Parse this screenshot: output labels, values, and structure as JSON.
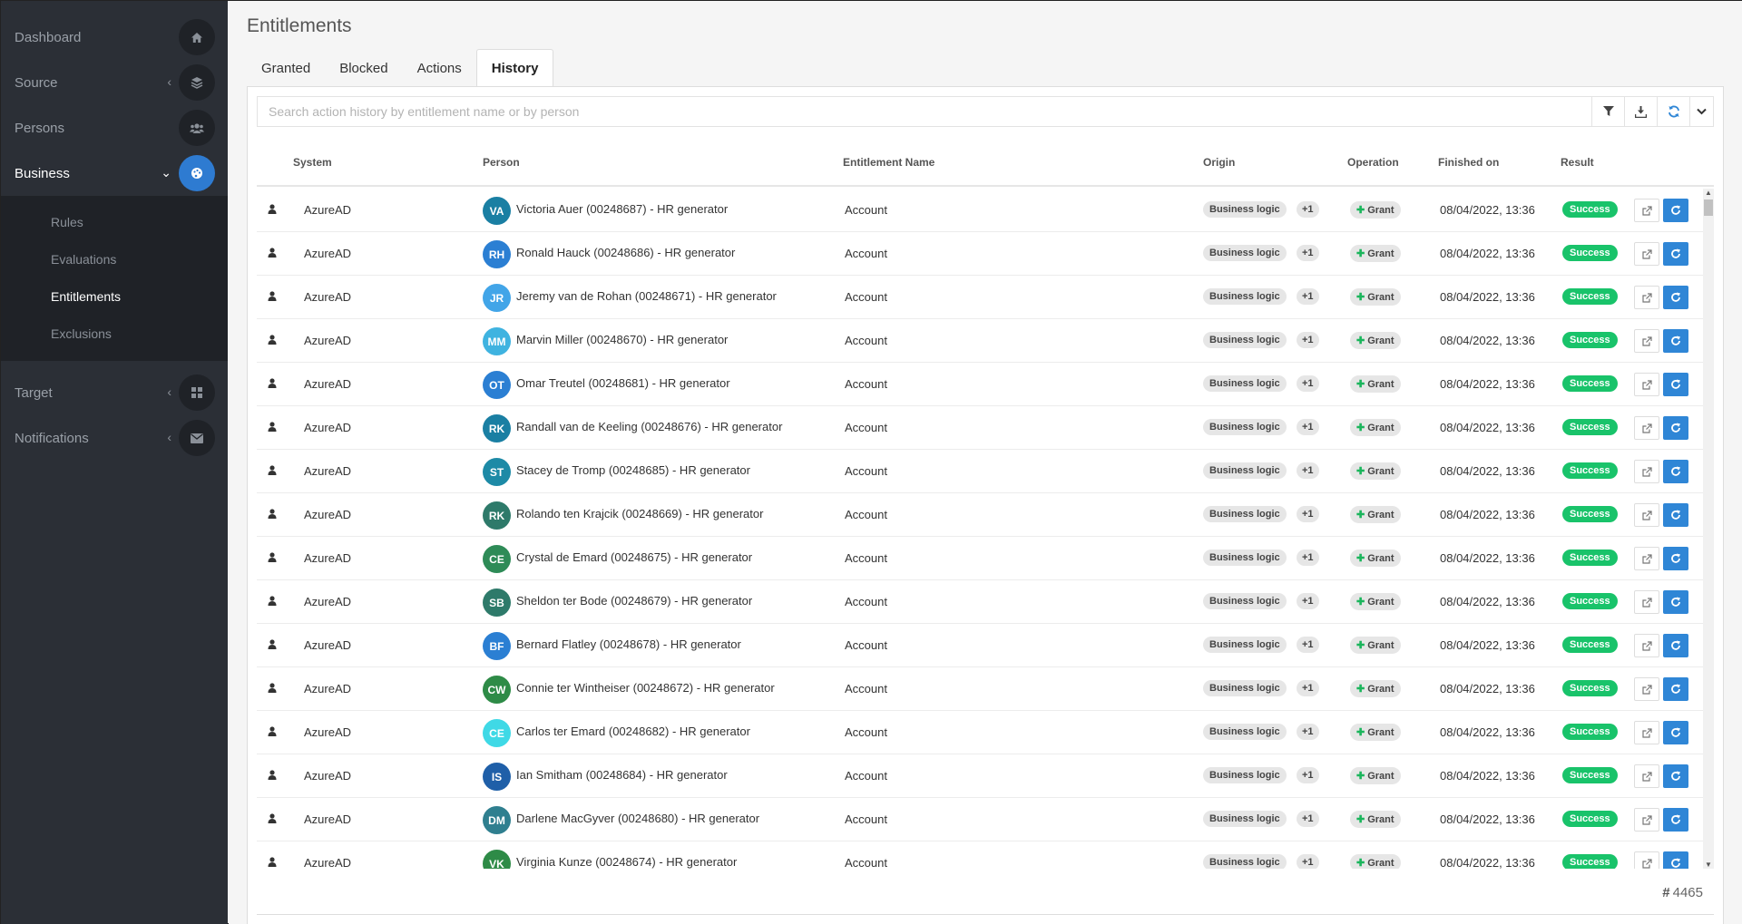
{
  "sidebar": {
    "items": [
      {
        "label": "Dashboard",
        "icon": "home-icon"
      },
      {
        "label": "Source",
        "icon": "layers-icon"
      },
      {
        "label": "Persons",
        "icon": "users-icon"
      },
      {
        "label": "Business",
        "icon": "palette-icon"
      },
      {
        "label": "Target",
        "icon": "grid-icon"
      },
      {
        "label": "Notifications",
        "icon": "envelope-icon"
      }
    ],
    "sub_items": [
      "Rules",
      "Evaluations",
      "Entitlements",
      "Exclusions"
    ]
  },
  "page": {
    "title": "Entitlements"
  },
  "tabs": [
    "Granted",
    "Blocked",
    "Actions",
    "History"
  ],
  "search": {
    "placeholder": "Search action history by entitlement name or by person"
  },
  "columns": {
    "system": "System",
    "person": "Person",
    "entitlement": "Entitlement Name",
    "origin": "Origin",
    "operation": "Operation",
    "finished": "Finished on",
    "result": "Result"
  },
  "rows": [
    {
      "system": "AzureAD",
      "initials": "VA",
      "color": "#1a7fa3",
      "person": "Victoria Auer (00248687) - HR generator",
      "entitlement": "Account",
      "origin": "Business logic",
      "extra": "+1",
      "operation": "Grant",
      "finished": "08/04/2022, 13:36",
      "result": "Success"
    },
    {
      "system": "AzureAD",
      "initials": "RH",
      "color": "#2b7fd3",
      "person": "Ronald Hauck (00248686) - HR generator",
      "entitlement": "Account",
      "origin": "Business logic",
      "extra": "+1",
      "operation": "Grant",
      "finished": "08/04/2022, 13:36",
      "result": "Success"
    },
    {
      "system": "AzureAD",
      "initials": "JR",
      "color": "#42a5e8",
      "person": "Jeremy van de Rohan (00248671) - HR generator",
      "entitlement": "Account",
      "origin": "Business logic",
      "extra": "+1",
      "operation": "Grant",
      "finished": "08/04/2022, 13:36",
      "result": "Success"
    },
    {
      "system": "AzureAD",
      "initials": "MM",
      "color": "#3fb3e0",
      "person": "Marvin Miller (00248670) - HR generator",
      "entitlement": "Account",
      "origin": "Business logic",
      "extra": "+1",
      "operation": "Grant",
      "finished": "08/04/2022, 13:36",
      "result": "Success"
    },
    {
      "system": "AzureAD",
      "initials": "OT",
      "color": "#2b7fd3",
      "person": "Omar Treutel (00248681) - HR generator",
      "entitlement": "Account",
      "origin": "Business logic",
      "extra": "+1",
      "operation": "Grant",
      "finished": "08/04/2022, 13:36",
      "result": "Success"
    },
    {
      "system": "AzureAD",
      "initials": "RK",
      "color": "#1a7fa3",
      "person": "Randall van de Keeling (00248676) - HR generator",
      "entitlement": "Account",
      "origin": "Business logic",
      "extra": "+1",
      "operation": "Grant",
      "finished": "08/04/2022, 13:36",
      "result": "Success"
    },
    {
      "system": "AzureAD",
      "initials": "ST",
      "color": "#1d8aa6",
      "person": "Stacey de Tromp (00248685) - HR generator",
      "entitlement": "Account",
      "origin": "Business logic",
      "extra": "+1",
      "operation": "Grant",
      "finished": "08/04/2022, 13:36",
      "result": "Success"
    },
    {
      "system": "AzureAD",
      "initials": "RK",
      "color": "#2e7a6a",
      "person": "Rolando ten Krajcik (00248669) - HR generator",
      "entitlement": "Account",
      "origin": "Business logic",
      "extra": "+1",
      "operation": "Grant",
      "finished": "08/04/2022, 13:36",
      "result": "Success"
    },
    {
      "system": "AzureAD",
      "initials": "CE",
      "color": "#2e8b57",
      "person": "Crystal de Emard (00248675) - HR generator",
      "entitlement": "Account",
      "origin": "Business logic",
      "extra": "+1",
      "operation": "Grant",
      "finished": "08/04/2022, 13:36",
      "result": "Success"
    },
    {
      "system": "AzureAD",
      "initials": "SB",
      "color": "#2e7a6a",
      "person": "Sheldon ter Bode (00248679) - HR generator",
      "entitlement": "Account",
      "origin": "Business logic",
      "extra": "+1",
      "operation": "Grant",
      "finished": "08/04/2022, 13:36",
      "result": "Success"
    },
    {
      "system": "AzureAD",
      "initials": "BF",
      "color": "#2b7fd3",
      "person": "Bernard Flatley (00248678) - HR generator",
      "entitlement": "Account",
      "origin": "Business logic",
      "extra": "+1",
      "operation": "Grant",
      "finished": "08/04/2022, 13:36",
      "result": "Success"
    },
    {
      "system": "AzureAD",
      "initials": "CW",
      "color": "#2e8b47",
      "person": "Connie ter Wintheiser (00248672) - HR generator",
      "entitlement": "Account",
      "origin": "Business logic",
      "extra": "+1",
      "operation": "Grant",
      "finished": "08/04/2022, 13:36",
      "result": "Success"
    },
    {
      "system": "AzureAD",
      "initials": "CE",
      "color": "#3fd9e6",
      "person": "Carlos ter Emard (00248682) - HR generator",
      "entitlement": "Account",
      "origin": "Business logic",
      "extra": "+1",
      "operation": "Grant",
      "finished": "08/04/2022, 13:36",
      "result": "Success"
    },
    {
      "system": "AzureAD",
      "initials": "IS",
      "color": "#1f5fa8",
      "person": "Ian Smitham (00248684) - HR generator",
      "entitlement": "Account",
      "origin": "Business logic",
      "extra": "+1",
      "operation": "Grant",
      "finished": "08/04/2022, 13:36",
      "result": "Success"
    },
    {
      "system": "AzureAD",
      "initials": "DM",
      "color": "#2f7f8f",
      "person": "Darlene MacGyver (00248680) - HR generator",
      "entitlement": "Account",
      "origin": "Business logic",
      "extra": "+1",
      "operation": "Grant",
      "finished": "08/04/2022, 13:36",
      "result": "Success"
    },
    {
      "system": "AzureAD",
      "initials": "VK",
      "color": "#2e8b47",
      "person": "Virginia Kunze (00248674) - HR generator",
      "entitlement": "Account",
      "origin": "Business logic",
      "extra": "+1",
      "operation": "Grant",
      "finished": "08/04/2022, 13:36",
      "result": "Success"
    }
  ],
  "footer": {
    "count": "4465"
  }
}
